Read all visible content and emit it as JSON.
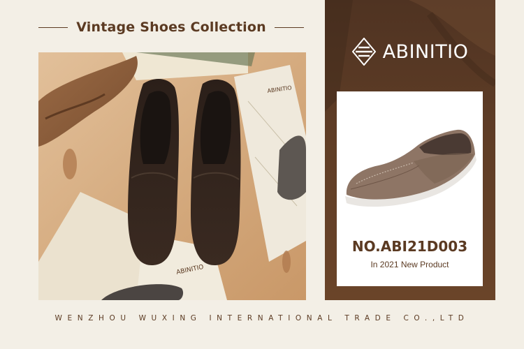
{
  "header": {
    "title": "Vintage Shoes Collection"
  },
  "brand": {
    "name": "ABINITIO",
    "logo_icon": "diamond-stripes-logo"
  },
  "photo": {
    "paper_brand": "ABINITIO",
    "icon": "dark-loafers-photo"
  },
  "product": {
    "code": "NO.ABI21D003",
    "subtitle": "In 2021 New Product",
    "icon": "taupe-suede-loafer"
  },
  "footer": {
    "company": "WENZHOU WUXING INTERNATIONAL TRADE CO.,LTD"
  },
  "colors": {
    "brand_brown": "#5b3a22",
    "panel_brown": "#5f3d26",
    "background": "#f3efe6"
  }
}
